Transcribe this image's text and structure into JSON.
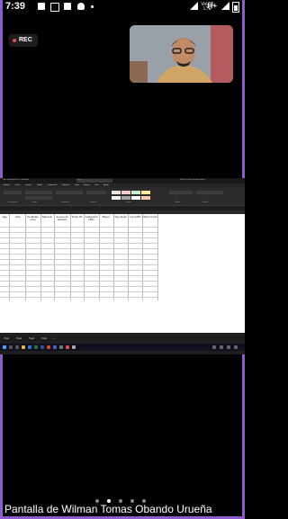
{
  "status_bar": {
    "time": "7:39",
    "network_top": "VoLTE",
    "network_bottom": "LTE",
    "mobile_type": "H+"
  },
  "recording": {
    "label": "REC"
  },
  "participant_video": {
    "person_icon": "person-webcam"
  },
  "shared_screen": {
    "window_title": "Libro de Notas Excel - Guardado",
    "search_placeholder": "Buscar",
    "user": "Wilman Tomas Obando Urueña",
    "menus": [
      "Archivo",
      "Inicio",
      "Insertar",
      "Dibujar",
      "Disposición",
      "Fórmulas",
      "Datos",
      "Revisar",
      "Vista",
      "Ayuda"
    ],
    "ribbon_groups": [
      "Portapapeles",
      "Fuente",
      "Alineación",
      "Número",
      "Estilos",
      "Celdas",
      "Edición"
    ],
    "columns": [
      "Age",
      "Pais",
      "Problema clave",
      "Mercado",
      "Acceso de usuarios",
      "Todos ID",
      "Alineación UBG",
      "Banco",
      "Tipo mano",
      "Con ADN",
      "Observación"
    ],
    "sheet_tabs": [
      "Hoja1",
      "Hoja2",
      "Hoja3",
      "Hoja4",
      "+"
    ],
    "accent": "#217346"
  },
  "caption": "Pantalla de Wilman Tomas Obando Urueña",
  "page_indicator": {
    "count": 5,
    "active": 1
  },
  "colors": {
    "border": "#8e5bd0",
    "rec_dot": "#e34b4b"
  }
}
